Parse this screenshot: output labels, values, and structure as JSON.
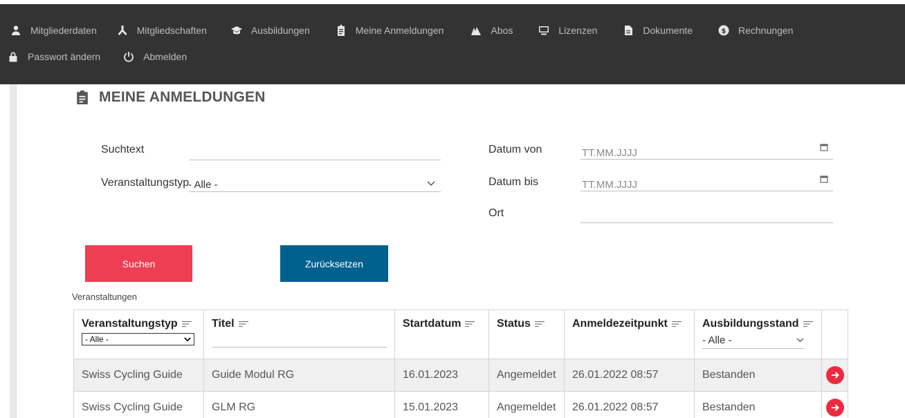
{
  "nav": {
    "row1": [
      {
        "label": "Mitgliederdaten",
        "icon": "user-icon"
      },
      {
        "label": "Mitgliedschaften",
        "icon": "network-icon"
      },
      {
        "label": "Ausbildungen",
        "icon": "graduation-cap-icon"
      },
      {
        "label": "Meine Anmeldungen",
        "icon": "clipboard-icon"
      },
      {
        "label": "Abos",
        "icon": "cycling-icon"
      },
      {
        "label": "Lizenzen",
        "icon": "monitor-icon"
      },
      {
        "label": "Dokumente",
        "icon": "file-icon"
      },
      {
        "label": "Rechnungen",
        "icon": "dollar-circle-icon"
      }
    ],
    "row2": [
      {
        "label": "Passwort ändern",
        "icon": "lock-icon"
      },
      {
        "label": "Abmelden",
        "icon": "power-icon"
      }
    ]
  },
  "page": {
    "title": "MEINE ANMELDUNGEN"
  },
  "filters": {
    "suchtext_label": "Suchtext",
    "suchtext_value": "",
    "typ_label": "Veranstaltungstyp",
    "typ_value": "- Alle -",
    "datum_von_label": "Datum von",
    "datum_von_placeholder": "TT.MM.JJJJ",
    "datum_bis_label": "Datum bis",
    "datum_bis_placeholder": "TT.MM.JJJJ",
    "ort_label": "Ort",
    "ort_value": ""
  },
  "buttons": {
    "search": "Suchen",
    "reset": "Zurücksetzen"
  },
  "table": {
    "section_label": "Veranstaltungen",
    "headers": {
      "typ": "Veranstaltungstyp",
      "titel": "Titel",
      "start": "Startdatum",
      "status": "Status",
      "anmelde": "Anmeldezeitpunkt",
      "stand": "Ausbildungsstand"
    },
    "typ_filter_value": "- Alle -",
    "stand_filter_value": "- Alle -",
    "rows": [
      {
        "typ": "Swiss Cycling Guide",
        "titel": "Guide Modul RG",
        "start": "16.01.2023",
        "status": "Angemeldet",
        "anmelde": "26.01.2022 08:57",
        "stand": "Bestanden"
      },
      {
        "typ": "Swiss Cycling Guide",
        "titel": "GLM RG",
        "start": "15.01.2023",
        "status": "Angemeldet",
        "anmelde": "26.01.2022 08:57",
        "stand": "Bestanden"
      }
    ]
  },
  "colors": {
    "nav_bg": "#333333",
    "primary_red": "#ee3e53",
    "primary_blue": "#00618e"
  }
}
